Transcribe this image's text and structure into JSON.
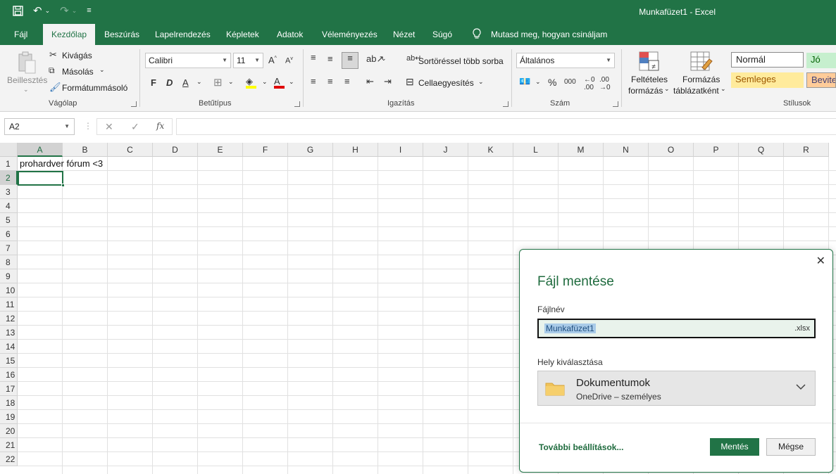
{
  "window": {
    "title": "Munkafüzet1  -  Excel"
  },
  "menu": {
    "tabs": [
      "Fájl",
      "Kezdőlap",
      "Beszúrás",
      "Lapelrendezés",
      "Képletek",
      "Adatok",
      "Véleményezés",
      "Nézet",
      "Súgó"
    ],
    "active": "Kezdőlap",
    "tell_me": "Mutasd meg, hogyan csináljam"
  },
  "ribbon": {
    "clipboard": {
      "paste": "Beillesztés",
      "cut": "Kivágás",
      "copy": "Másolás",
      "format_painter": "Formátummásoló",
      "label": "Vágólap"
    },
    "font": {
      "name": "Calibri",
      "size": "11",
      "label": "Betűtípus",
      "bold": "F",
      "italic": "D",
      "underline": "A"
    },
    "alignment": {
      "wrap": "Sortöréssel több sorba",
      "merge": "Cellaegyesítés",
      "label": "Igazítás"
    },
    "number": {
      "format": "Általános",
      "label": "Szám",
      "percent": "%",
      "thousands": "000"
    },
    "styles": {
      "conditional_1": "Feltételes",
      "conditional_2": "formázás",
      "table_1": "Formázás",
      "table_2": "táblázatként",
      "normal": "Normál",
      "good": "Jó",
      "neutral": "Semleges",
      "input": "Bevite",
      "label": "Stílusok"
    }
  },
  "formula_bar": {
    "name_box": "A2",
    "fx": "fx",
    "content": ""
  },
  "grid": {
    "columns": [
      "A",
      "B",
      "C",
      "D",
      "E",
      "F",
      "G",
      "H",
      "I",
      "J",
      "K",
      "L",
      "M",
      "N",
      "O",
      "P",
      "Q",
      "R"
    ],
    "rows": [
      "1",
      "2",
      "3",
      "4",
      "5",
      "6",
      "7",
      "8",
      "9",
      "10",
      "11",
      "12",
      "13",
      "14",
      "15",
      "16",
      "17",
      "18",
      "19",
      "20",
      "21",
      "22"
    ],
    "cell_A1": "prohardver fórum <3",
    "active_cell": "A2"
  },
  "save_dialog": {
    "title": "Fájl mentése",
    "filename_label": "Fájlnév",
    "filename": "Munkafüzet1",
    "extension": ".xlsx",
    "location_label": "Hely kiválasztása",
    "location_name": "Dokumentumok",
    "location_sub": "OneDrive – személyes",
    "more_options": "További beállítások...",
    "save_button": "Mentés",
    "cancel_button": "Mégse"
  },
  "colors": {
    "accent": "#217346",
    "good_bg": "#c6efce",
    "good_fg": "#006100",
    "neutral_bg": "#ffeb9c",
    "neutral_fg": "#9c5700",
    "input_bg": "#ffcc99",
    "input_fg": "#3f3f76"
  }
}
